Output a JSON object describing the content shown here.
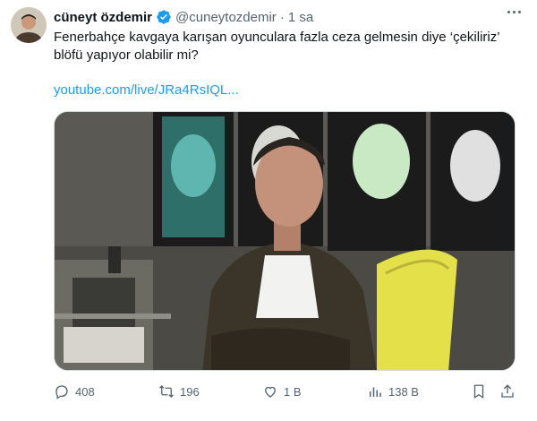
{
  "tweet": {
    "author_name": "cüneyt özdemir",
    "handle": "@cuneytozdemir",
    "separator": "·",
    "time": "1 sa",
    "text_line1": "Fenerbahçe kavgaya karışan oyunculara fazla ceza gelmesin diye ‘çekiliriz’",
    "text_line2": "blöfü yapıyor olabilir mi?",
    "link": "youtube.com/live/JRa4RsIQL..."
  },
  "media": {
    "description_icon": "video-thumbnail"
  },
  "actions": {
    "replies": "408",
    "retweets": "196",
    "likes": "1 B",
    "views": "138 B"
  },
  "colors": {
    "accent": "#1d9bf0",
    "secondary_text": "#536471",
    "chair": "#e4e04a"
  },
  "icons": [
    "verified-badge-icon",
    "more-options-icon",
    "reply-icon",
    "retweet-icon",
    "like-icon",
    "views-icon",
    "bookmark-icon",
    "share-icon"
  ]
}
